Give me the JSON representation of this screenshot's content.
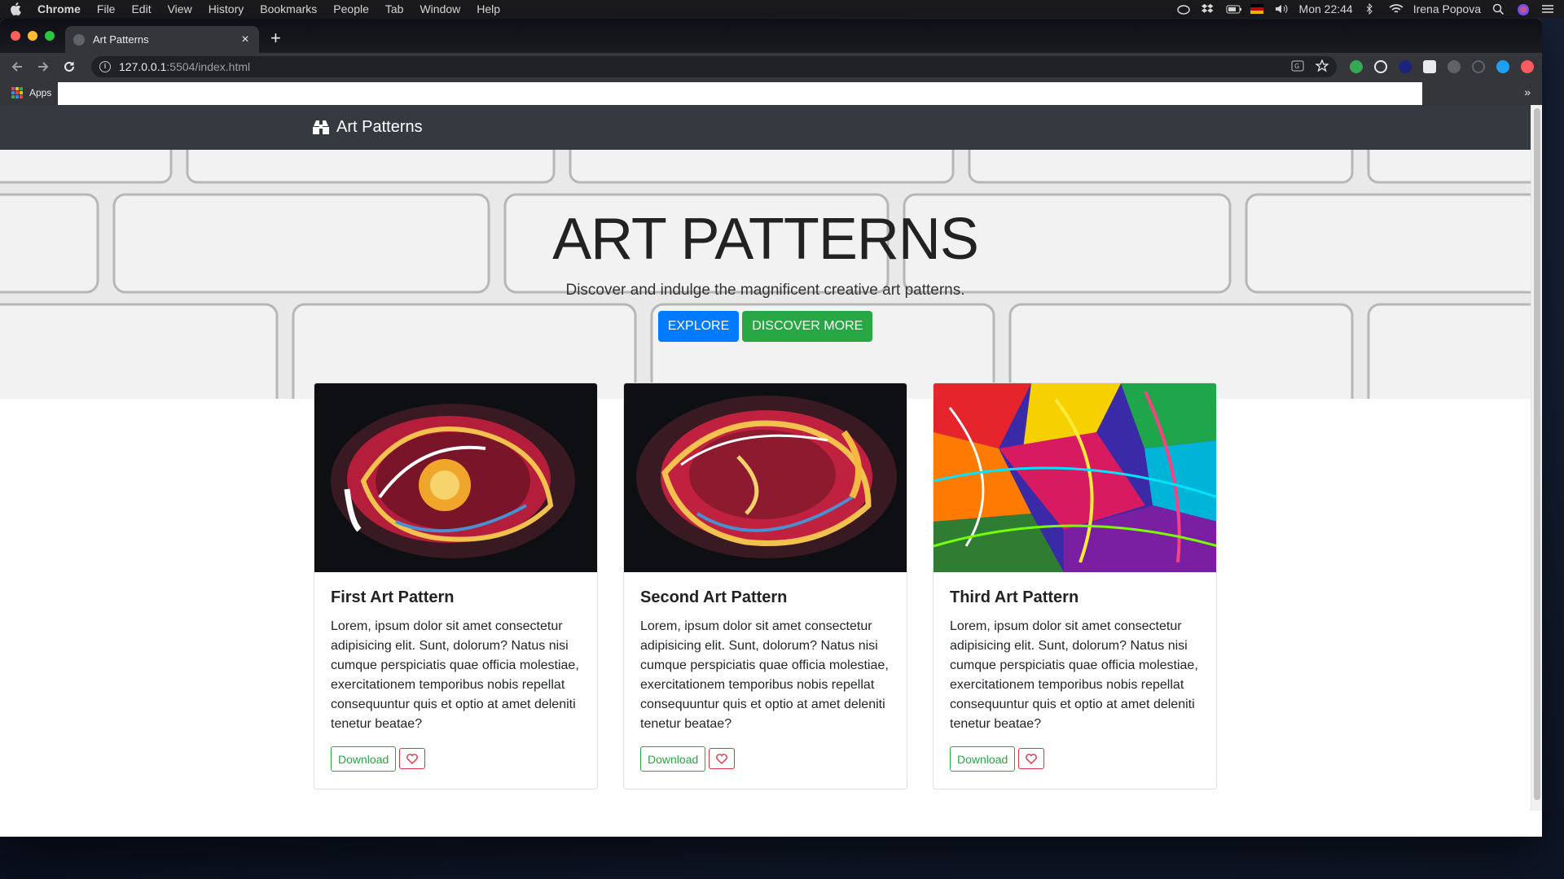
{
  "menubar": {
    "app": "Chrome",
    "items": [
      "File",
      "Edit",
      "View",
      "History",
      "Bookmarks",
      "People",
      "Tab",
      "Window",
      "Help"
    ],
    "clock": "Mon 22:44",
    "user": "Irena Popova"
  },
  "browser": {
    "tab_title": "Art Patterns",
    "url_host": "127.0.0.1",
    "url_path": ":5504/index.html",
    "bookmarks_apps": "Apps"
  },
  "site": {
    "brand": "Art Patterns",
    "hero": {
      "title": "ART PATTERNS",
      "subtitle": "Discover and indulge the magnificent creative art patterns.",
      "explore_label": "EXPLORE",
      "discover_label": "DISCOVER MORE"
    },
    "cards": [
      {
        "title": "First Art Pattern",
        "text": "Lorem, ipsum dolor sit amet consectetur adipisicing elit. Sunt, dolorum? Natus nisi cumque perspiciatis quae officia molestiae, exercitationem temporibus nobis repellat consequuntur quis et optio at amet deleniti tenetur beatae?",
        "download_label": "Download"
      },
      {
        "title": "Second Art Pattern",
        "text": "Lorem, ipsum dolor sit amet consectetur adipisicing elit. Sunt, dolorum? Natus nisi cumque perspiciatis quae officia molestiae, exercitationem temporibus nobis repellat consequuntur quis et optio at amet deleniti tenetur beatae?",
        "download_label": "Download"
      },
      {
        "title": "Third Art Pattern",
        "text": "Lorem, ipsum dolor sit amet consectetur adipisicing elit. Sunt, dolorum? Natus nisi cumque perspiciatis quae officia molestiae, exercitationem temporibus nobis repellat consequuntur quis et optio at amet deleniti tenetur beatae?",
        "download_label": "Download"
      }
    ]
  },
  "colors": {
    "navbar": "#343a40",
    "primary": "#007bff",
    "success": "#28a745",
    "danger": "#dc3545"
  }
}
